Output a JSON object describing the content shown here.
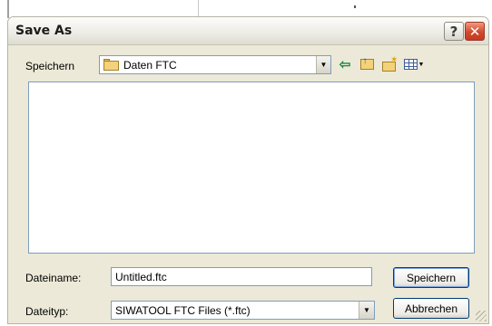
{
  "dialog": {
    "title": "Save As",
    "help_glyph": "?",
    "close_glyph": "✕"
  },
  "toolbar": {
    "save_in_label": "Speichern",
    "location": "Daten FTC",
    "dropdown_glyph": "▼",
    "back_glyph": "⇦",
    "views_dropdown_glyph": "▼",
    "icons": [
      "folder-icon",
      "back-arrow-icon",
      "up-folder-icon",
      "new-folder-icon",
      "views-menu-icon"
    ]
  },
  "file_list": {
    "items": []
  },
  "fields": {
    "filename_label": "Dateiname:",
    "filename_value": "Untitled.ftc",
    "filetype_label": "Dateityp:",
    "filetype_value": "SIWATOOL FTC Files (*.ftc)",
    "dropdown_glyph": "▼"
  },
  "buttons": {
    "save": "Speichern",
    "cancel": "Abbrechen"
  },
  "colors": {
    "dialog_bg": "#ece9d8",
    "border_accent": "#7f9db9",
    "close_red": "#d24a2d"
  }
}
